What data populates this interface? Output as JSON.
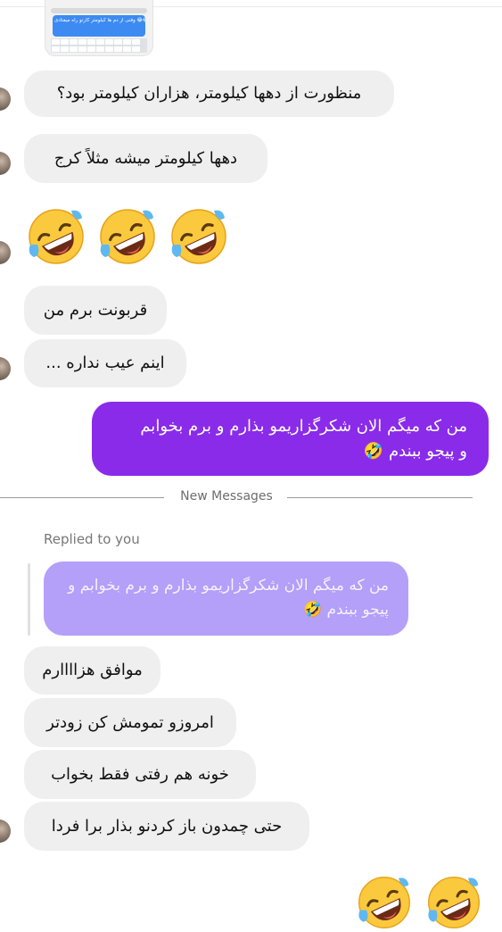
{
  "thread": {
    "thumbnail_caption": "وقتی از دم ها کیلومتر کارتو راه میفتادی 😂😂😂",
    "received_1": "منظورت از دهها کیلومتر، هزاران کیلومتر بود؟",
    "received_2": "دهها کیلومتر میشه مثلاً کرج",
    "emoji_reaction": "rolling-on-floor-laughing",
    "received_3": "قربونت برم من",
    "received_4": "اینم عیب نداره ...",
    "sent_line1": "من که میگم الان شکرگزاریمو بذارم و برم بخوابم",
    "sent_line2": "و پیجو ببندم 🤣",
    "new_messages_label": "New Messages",
    "replied_label": "Replied to you",
    "quoted_line1": "من که میگم الان شکرگزاریمو بذارم و برم بخوابم و",
    "quoted_line2": "پیجو ببندم 🤣",
    "received_5": "موافق هزاااارم",
    "received_6": "امروزو تمومش کن زودتر",
    "received_7": "خونه هم رفتی فقط بخواب",
    "received_8": "حتی چمدون باز کردنو بذار برا فردا"
  },
  "colors": {
    "sent_bubble": "#8a2bea",
    "quoted_bubble": "#b49ff9",
    "received_bubble": "#efefef",
    "emoji_face": "#fbc93d",
    "tears": "#5fb8f0"
  }
}
